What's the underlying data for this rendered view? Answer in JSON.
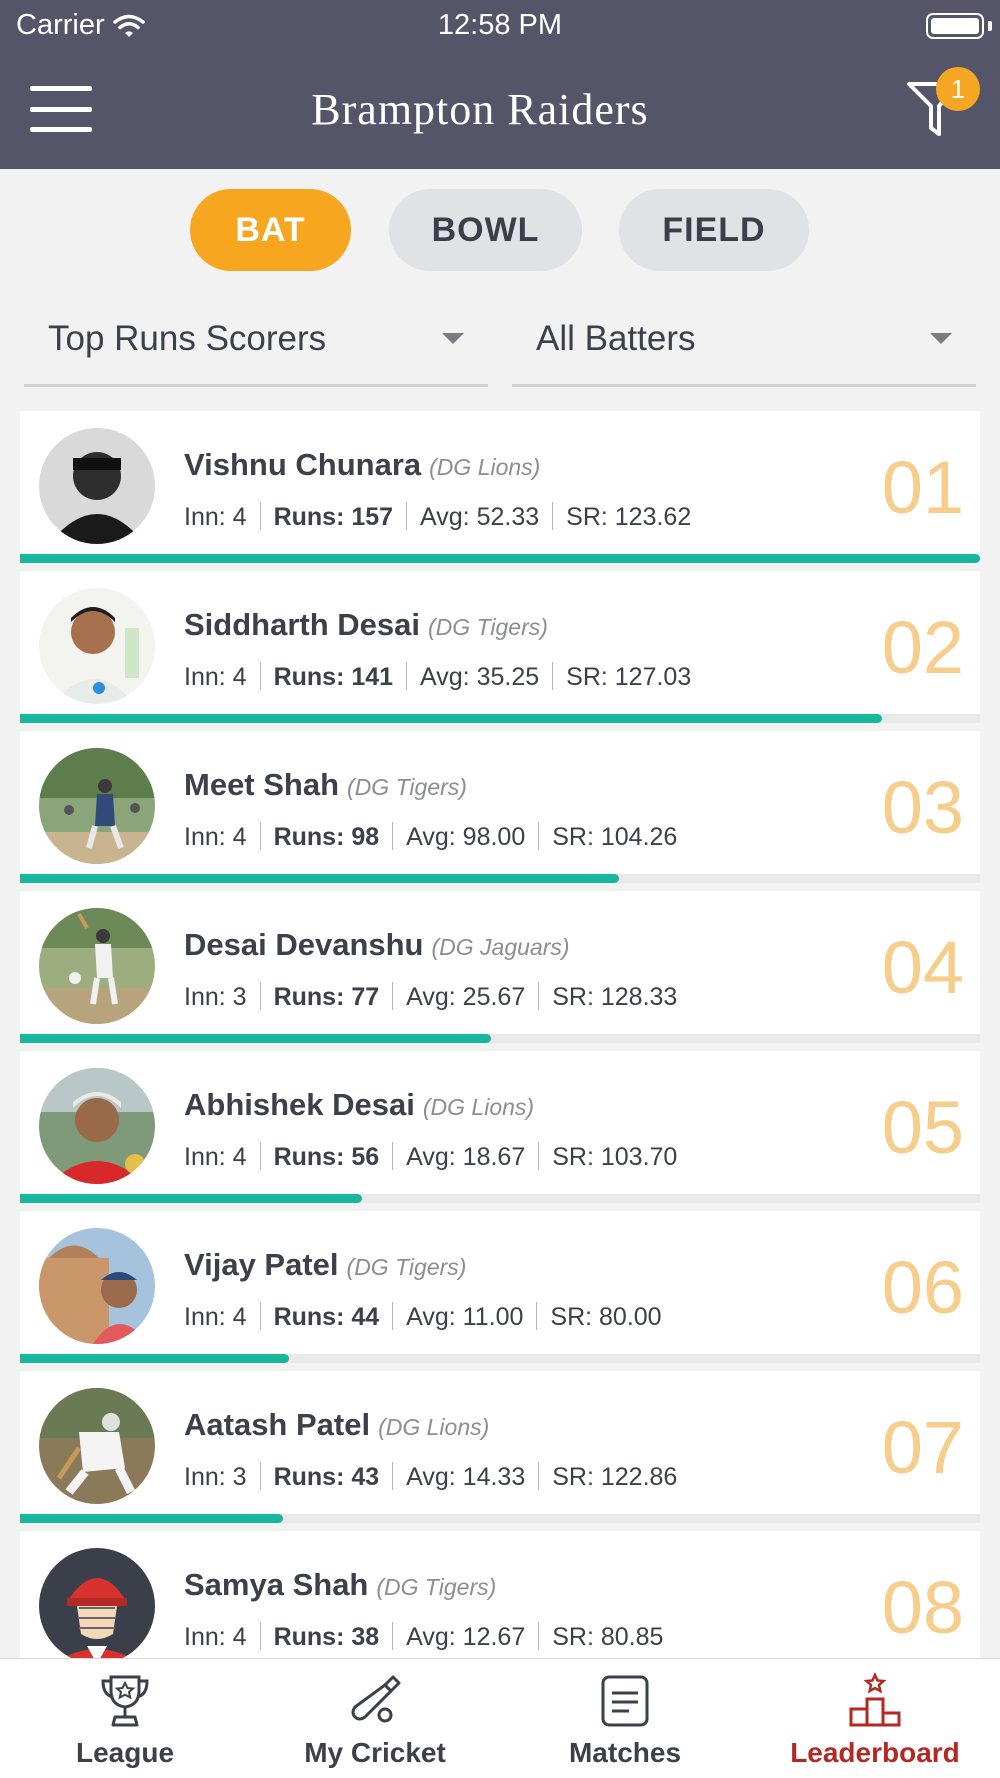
{
  "status_bar": {
    "carrier": "Carrier",
    "time": "12:58 PM"
  },
  "header": {
    "title": "Brampton Raiders",
    "filter_badge": "1"
  },
  "tabs": [
    {
      "label": "BAT",
      "active": true
    },
    {
      "label": "BOWL",
      "active": false
    },
    {
      "label": "FIELD",
      "active": false
    }
  ],
  "dropdowns": {
    "stat_type": "Top Runs Scorers",
    "player_type": "All Batters"
  },
  "players": [
    {
      "name": "Vishnu Chunara",
      "team": "(DG Lions)",
      "inn_label": "Inn: 4",
      "runs_label": "Runs: 157",
      "avg_label": "Avg: 52.33",
      "sr_label": "SR: 123.62",
      "rank": "01",
      "runs": 157
    },
    {
      "name": "Siddharth Desai",
      "team": "(DG Tigers)",
      "inn_label": "Inn: 4",
      "runs_label": "Runs: 141",
      "avg_label": "Avg: 35.25",
      "sr_label": "SR: 127.03",
      "rank": "02",
      "runs": 141
    },
    {
      "name": "Meet Shah",
      "team": "(DG Tigers)",
      "inn_label": "Inn: 4",
      "runs_label": "Runs: 98",
      "avg_label": "Avg: 98.00",
      "sr_label": "SR: 104.26",
      "rank": "03",
      "runs": 98
    },
    {
      "name": "Desai Devanshu",
      "team": "(DG Jaguars)",
      "inn_label": "Inn: 3",
      "runs_label": "Runs: 77",
      "avg_label": "Avg: 25.67",
      "sr_label": "SR: 128.33",
      "rank": "04",
      "runs": 77
    },
    {
      "name": "Abhishek Desai",
      "team": "(DG Lions)",
      "inn_label": "Inn: 4",
      "runs_label": "Runs: 56",
      "avg_label": "Avg: 18.67",
      "sr_label": "SR: 103.70",
      "rank": "05",
      "runs": 56
    },
    {
      "name": "Vijay Patel",
      "team": "(DG Tigers)",
      "inn_label": "Inn: 4",
      "runs_label": "Runs: 44",
      "avg_label": "Avg: 11.00",
      "sr_label": "SR: 80.00",
      "rank": "06",
      "runs": 44
    },
    {
      "name": "Aatash Patel",
      "team": "(DG Lions)",
      "inn_label": "Inn: 3",
      "runs_label": "Runs: 43",
      "avg_label": "Avg: 14.33",
      "sr_label": "SR: 122.86",
      "rank": "07",
      "runs": 43
    },
    {
      "name": "Samya Shah",
      "team": "(DG Tigers)",
      "inn_label": "Inn: 4",
      "runs_label": "Runs: 38",
      "avg_label": "Avg: 12.67",
      "sr_label": "SR: 80.85",
      "rank": "08",
      "runs": 38
    }
  ],
  "bottom_nav": [
    {
      "label": "League",
      "icon": "trophy-icon",
      "active": false
    },
    {
      "label": "My Cricket",
      "icon": "cricket-bat-icon",
      "active": false
    },
    {
      "label": "Matches",
      "icon": "scorecard-icon",
      "active": false
    },
    {
      "label": "Leaderboard",
      "icon": "podium-icon",
      "active": true
    }
  ],
  "colors": {
    "header_bg": "#545569",
    "accent": "#f7a620",
    "progress": "#17b79c",
    "rank": "#f6cd8a",
    "active_nav": "#b22a23"
  }
}
